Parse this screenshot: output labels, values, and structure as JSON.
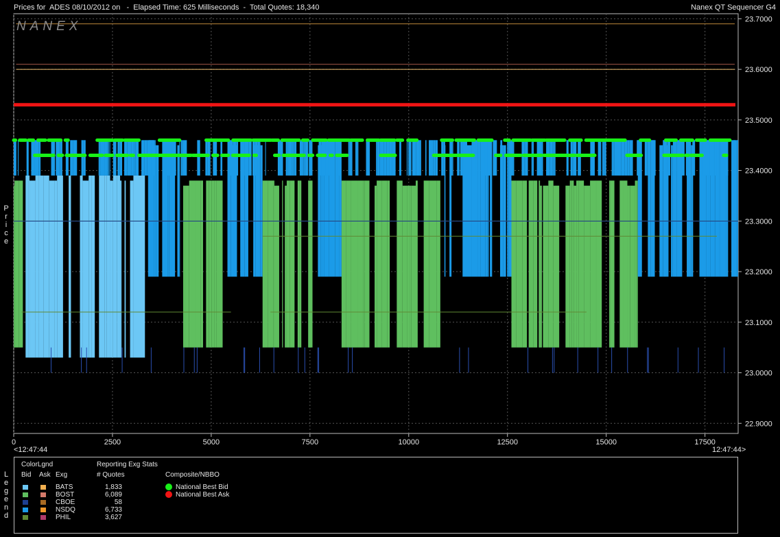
{
  "header": {
    "title": "Prices for  ADES 08/10/2012 on   -  Elapsed Time: 625 Milliseconds  -  Total Quotes: 18,340",
    "app_name": "Nanex QT Sequencer G4",
    "watermark": "NANEX"
  },
  "axis": {
    "ylabel": "Price",
    "time_start": "<12:47:44",
    "time_end": "12:47:44>"
  },
  "legend": {
    "label": "Legend",
    "colorlgnd_title": "ColorLgnd",
    "col_bid": "Bid",
    "col_ask": "Ask",
    "col_exg": "Exg",
    "stats_title": "Reporting Exg Stats",
    "stats_col": "# Quotes",
    "composite_title": "Composite/NBBO",
    "exchanges": [
      {
        "name": "BATS",
        "quotes": "1,833",
        "bid_color": "#6cc7f5",
        "ask_color": "#f2b050"
      },
      {
        "name": "BOST",
        "quotes": "6,089",
        "bid_color": "#5fbf5f",
        "ask_color": "#d47a6a"
      },
      {
        "name": "CBOE",
        "quotes": "58",
        "bid_color": "#1d3f8f",
        "ask_color": "#a86a22"
      },
      {
        "name": "NSDQ",
        "quotes": "6,733",
        "bid_color": "#1b9be8",
        "ask_color": "#f09628"
      },
      {
        "name": "PHIL",
        "quotes": "3,627",
        "bid_color": "#5f8a34",
        "ask_color": "#b03a6a"
      }
    ],
    "nbbo": [
      {
        "name": "National Best Bid",
        "color": "#18f018"
      },
      {
        "name": "National Best Ask",
        "color": "#f01414"
      }
    ]
  },
  "chart_data": {
    "type": "area",
    "xlabel": "",
    "ylabel": "Price",
    "xlim": [
      0,
      18340
    ],
    "ylim": [
      22.88,
      23.71
    ],
    "x_ticks": [
      0,
      2500,
      5000,
      7500,
      10000,
      12500,
      15000,
      17500
    ],
    "y_ticks": [
      "22.9000",
      "23.0000",
      "23.1000",
      "23.2000",
      "23.3000",
      "23.4000",
      "23.5000",
      "23.6000",
      "23.7000"
    ],
    "y_tick_values": [
      22.9,
      23.0,
      23.1,
      23.2,
      23.3,
      23.4,
      23.5,
      23.6,
      23.7
    ],
    "grid": true,
    "series": [
      {
        "name": "National Best Ask",
        "color": "#f01414",
        "level": 23.53
      },
      {
        "name": "National Best Bid",
        "color": "#18f018",
        "levels": [
          23.46,
          23.43
        ]
      },
      {
        "name": "BATS",
        "color": "#6cc7f5",
        "bid": 23.03,
        "ask": 23.39
      },
      {
        "name": "BOST",
        "color": "#5fbf5f",
        "bid": 23.05,
        "ask": 23.38
      },
      {
        "name": "NSDQ",
        "color": "#1b9be8",
        "bid": 23.19,
        "ask": 23.46
      },
      {
        "name": "PHIL",
        "color": "#5f8a34",
        "bid": 23.12,
        "ask": 23.39
      },
      {
        "name": "CBOE",
        "color": "#1d3f8f",
        "bid": 23.0,
        "ask": 23.3
      }
    ],
    "ask_lines": [
      23.69,
      23.61,
      23.6
    ]
  }
}
